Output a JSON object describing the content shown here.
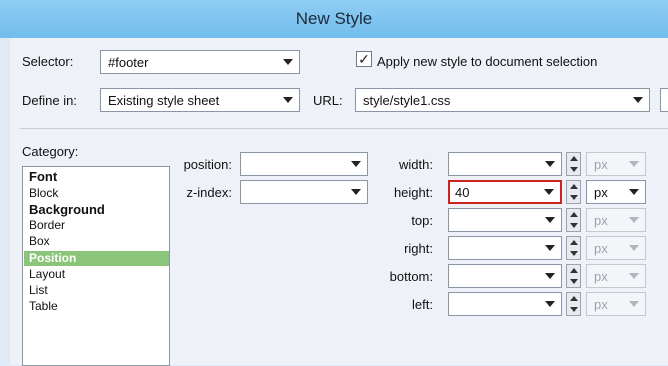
{
  "window": {
    "title": "New Style"
  },
  "selector": {
    "label": "Selector:",
    "value": "#footer"
  },
  "apply_checkbox": {
    "label": "Apply new style to document selection",
    "checked_glyph": "✓"
  },
  "define_in": {
    "label": "Define in:",
    "value": "Existing style sheet"
  },
  "url": {
    "label": "URL:",
    "value": "style/style1.css"
  },
  "category": {
    "label": "Category:",
    "items": [
      "Font",
      "Block",
      "Background",
      "Border",
      "Box",
      "Position",
      "Layout",
      "List",
      "Table"
    ],
    "selected": "Position"
  },
  "position": {
    "label": "position:",
    "value": ""
  },
  "zindex": {
    "label": "z-index:",
    "value": ""
  },
  "fields": {
    "width": {
      "label": "width:",
      "value": "",
      "unit": "px"
    },
    "height": {
      "label": "height:",
      "value": "40",
      "unit": "px"
    },
    "top": {
      "label": "top:",
      "value": "",
      "unit": "px"
    },
    "right": {
      "label": "right:",
      "value": "",
      "unit": "px"
    },
    "bottom": {
      "label": "bottom:",
      "value": "",
      "unit": "px"
    },
    "left": {
      "label": "left:",
      "value": "",
      "unit": "px"
    }
  },
  "colors": {
    "title_bar": "#7cc4ef",
    "selected_category": "#8bc57a",
    "height_highlight": "#cc2222"
  }
}
